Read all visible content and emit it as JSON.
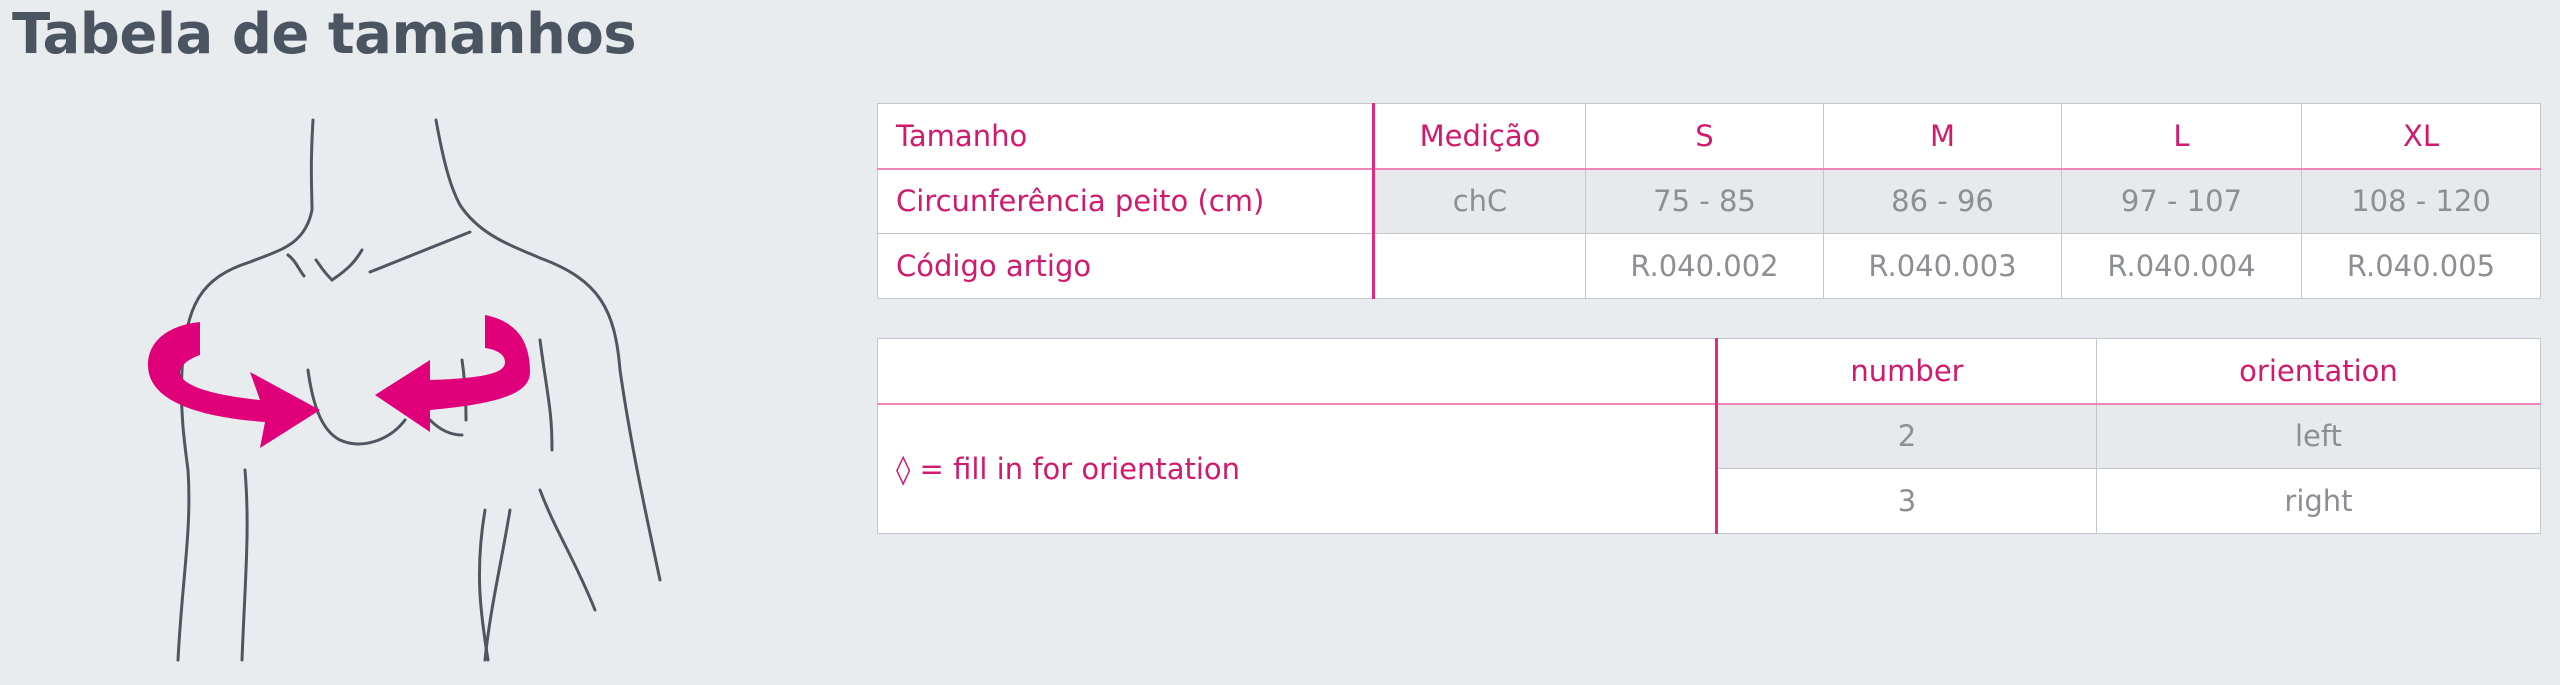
{
  "title": "Tabela de tamanhos",
  "size_table": {
    "header": {
      "label": "Tamanho",
      "measure": "Medição",
      "sizes": [
        "S",
        "M",
        "L",
        "XL"
      ]
    },
    "rows": [
      {
        "label": "Circunferência peito (cm)",
        "measure": "chC",
        "values": [
          "75 - 85",
          "86 - 96",
          "97 - 107",
          "108 - 120"
        ]
      },
      {
        "label": "Código artigo",
        "measure": "",
        "values": [
          "R.040.002",
          "R.040.003",
          "R.040.004",
          "R.040.005"
        ]
      }
    ]
  },
  "orientation_table": {
    "header": {
      "number": "number",
      "orientation": "orientation"
    },
    "note": "◊ = fill in for orientation",
    "rows": [
      {
        "number": "2",
        "orientation": "left"
      },
      {
        "number": "3",
        "orientation": "right"
      }
    ]
  },
  "colors": {
    "accent": "#e0007a",
    "title": "#4a5561",
    "text_pink": "#d11a6e",
    "text_gray": "#8c8f93"
  },
  "icons": {
    "figure": "chest-measurement-icon"
  }
}
